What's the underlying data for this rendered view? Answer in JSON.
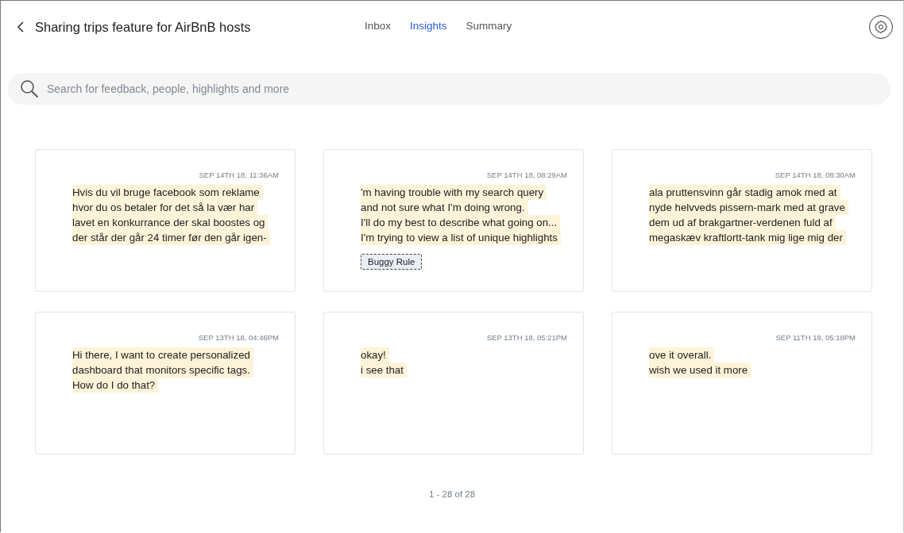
{
  "header": {
    "title": "Sharing trips feature for AirBnB hosts"
  },
  "tabs": [
    {
      "label": "Inbox",
      "selected": false
    },
    {
      "label": "Insights",
      "selected": true
    },
    {
      "label": "Summary",
      "selected": false
    }
  ],
  "search": {
    "placeholder": "Search for feedback, people, highlights and more"
  },
  "cards": [
    {
      "date": "SEP 14TH 18, 11:36AM",
      "lines": [
        "Hvis du vil bruge facebook som reklame",
        "hvor du os betaler for det så la vær har",
        "lavet en konkurrance der skal boostes og",
        "der står der går 24 timer før den går igen-"
      ]
    },
    {
      "date": "SEP 14TH 18, 08:29AM",
      "lines": [
        "'m having trouble with my search query",
        "and not sure what I'm doing wrong.",
        "I'll do my best to describe what going on...",
        "I'm trying to view a list of unique highlights"
      ],
      "tags": [
        "Buggy Rule"
      ]
    },
    {
      "date": "SEP 14TH 18, 08:30AM",
      "lines": [
        "ala pruttensvinn går stadig amok med at",
        "nyde helvveds pissern-mark med at grave",
        "dem ud af brakgartner-verdenen fuld af",
        "megaskæv kraftlortt-tank mig lige mig der"
      ]
    },
    {
      "date": "SEP 13TH 18, 04:46PM",
      "lines": [
        "Hi there, I want to create personalized",
        "dashboard that monitors specific tags.",
        "How do I do that?"
      ]
    },
    {
      "date": "SEP 13TH 18, 05:21PM",
      "lines": [
        "okay!",
        "i see that"
      ]
    },
    {
      "date": "SEP 11TH 18, 05:18PM",
      "lines": [
        "ove it overall.",
        "wish we used it more"
      ]
    }
  ],
  "pagination": "1 - 28 of 28"
}
